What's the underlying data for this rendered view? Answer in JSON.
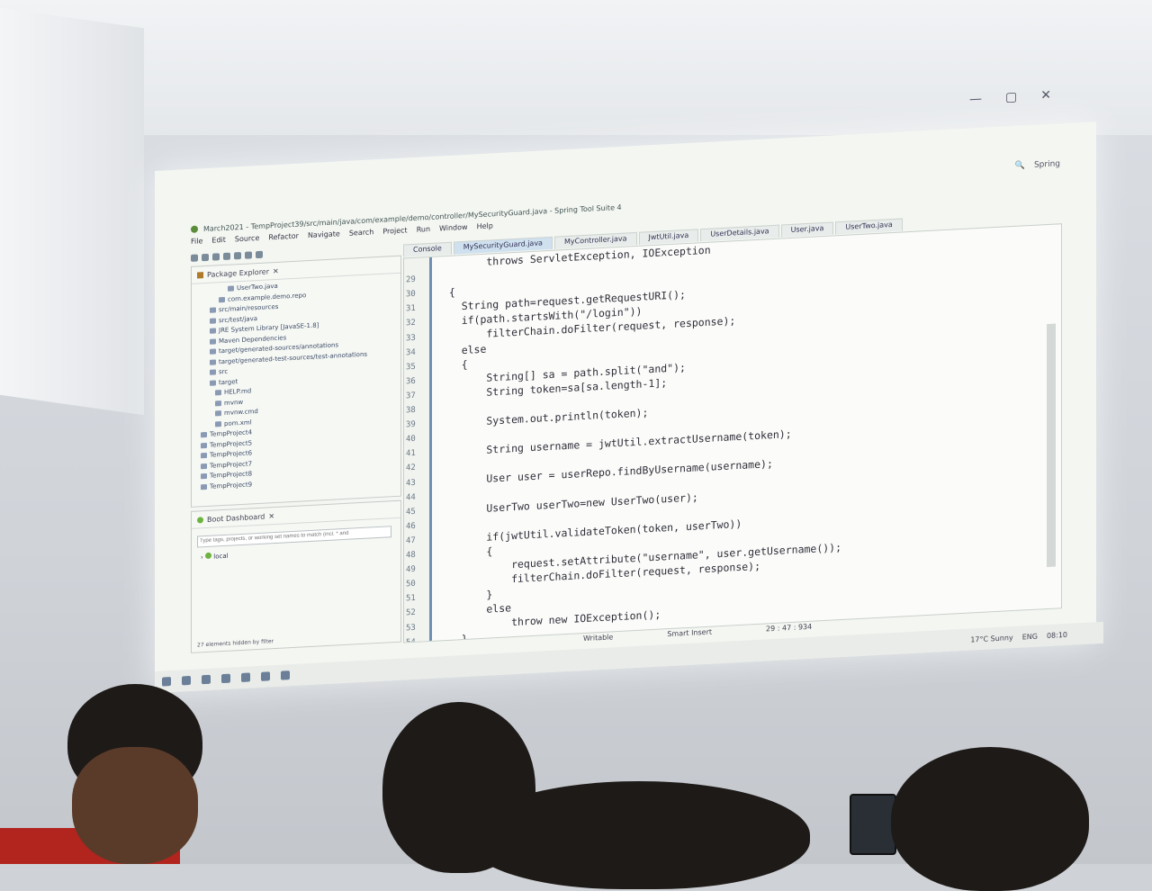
{
  "window": {
    "title": "March2021 - TempProject39/src/main/java/com/example/demo/controller/MySecurityGuard.java - Spring Tool Suite 4",
    "controls": [
      "—",
      "▢",
      "✕"
    ],
    "perspective": "Spring"
  },
  "menu": [
    "File",
    "Edit",
    "Source",
    "Refactor",
    "Navigate",
    "Search",
    "Project",
    "Run",
    "Window",
    "Help"
  ],
  "package_explorer": {
    "title": "Package Explorer",
    "items": [
      "UserTwo.java",
      "com.example.demo.repo",
      "src/main/resources",
      "src/test/java",
      "JRE System Library [JavaSE-1.8]",
      "Maven Dependencies",
      "target/generated-sources/annotations",
      "target/generated-test-sources/test-annotations",
      "src",
      "target",
      "HELP.md",
      "mvnw",
      "mvnw.cmd",
      "pom.xml",
      "TempProject4",
      "TempProject5",
      "TempProject6",
      "TempProject7",
      "TempProject8",
      "TempProject9"
    ]
  },
  "boot_dashboard": {
    "title": "Boot Dashboard",
    "filter_placeholder": "Type tags, projects, or working set names to match (incl. * and",
    "local": "local",
    "hidden_note": "27 elements hidden by filter"
  },
  "editor_tabs": [
    {
      "label": "Console",
      "active": false
    },
    {
      "label": "MySecurityGuard.java",
      "active": true
    },
    {
      "label": "MyController.java",
      "active": false
    },
    {
      "label": "JwtUtil.java",
      "active": false
    },
    {
      "label": "UserDetails.java",
      "active": false
    },
    {
      "label": "User.java",
      "active": false
    },
    {
      "label": "UserTwo.java",
      "active": false
    }
  ],
  "code": {
    "lines": [
      {
        "n": "",
        "text": "        throws ServletException, IOException"
      },
      {
        "n": "29",
        "text": ""
      },
      {
        "n": "30",
        "text": "  {"
      },
      {
        "n": "31",
        "text": "    String path=request.getRequestURI();"
      },
      {
        "n": "32",
        "text": "    if(path.startsWith(\"/login\"))"
      },
      {
        "n": "33",
        "text": "        filterChain.doFilter(request, response);"
      },
      {
        "n": "34",
        "text": "    else"
      },
      {
        "n": "35",
        "text": "    {"
      },
      {
        "n": "36",
        "text": "        String[] sa = path.split(\"and\");"
      },
      {
        "n": "37",
        "text": "        String token=sa[sa.length-1];"
      },
      {
        "n": "38",
        "text": ""
      },
      {
        "n": "39",
        "text": "        System.out.println(token);"
      },
      {
        "n": "40",
        "text": ""
      },
      {
        "n": "41",
        "text": "        String username = jwtUtil.extractUsername(token);"
      },
      {
        "n": "42",
        "text": ""
      },
      {
        "n": "43",
        "text": "        User user = userRepo.findByUsername(username);"
      },
      {
        "n": "44",
        "text": ""
      },
      {
        "n": "45",
        "text": "        UserTwo userTwo=new UserTwo(user);"
      },
      {
        "n": "46",
        "text": ""
      },
      {
        "n": "47",
        "text": "        if(jwtUtil.validateToken(token, userTwo))"
      },
      {
        "n": "48",
        "text": "        {"
      },
      {
        "n": "49",
        "text": "            request.setAttribute(\"username\", user.getUsername());"
      },
      {
        "n": "50",
        "text": "            filterChain.doFilter(request, response);"
      },
      {
        "n": "51",
        "text": "        }"
      },
      {
        "n": "52",
        "text": "        else"
      },
      {
        "n": "53",
        "text": "            throw new IOException();"
      },
      {
        "n": "54",
        "text": "    }"
      },
      {
        "n": "55",
        "text": ""
      }
    ]
  },
  "status": {
    "mode": "Writable",
    "insert": "Smart Insert",
    "position": "29 : 47 : 934"
  },
  "taskbar": {
    "weather": "17°C Sunny",
    "lang": "ENG",
    "time": "08:10"
  },
  "colors": {
    "accent": "#6f8fb5",
    "keyword": "#7f0055",
    "string": "#2a00ff",
    "field": "#0000c0"
  }
}
